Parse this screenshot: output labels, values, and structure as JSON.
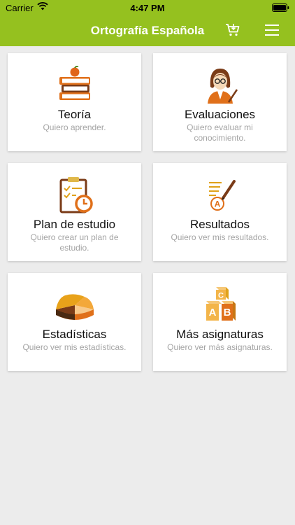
{
  "status_bar": {
    "carrier": "Carrier",
    "time": "4:47 PM"
  },
  "nav": {
    "title": "Ortografía Española",
    "cart_icon": "shopping-cart-icon",
    "menu_icon": "hamburger-menu-icon"
  },
  "colors": {
    "nav_background": "#95c11f",
    "page_background": "#ececec",
    "card_background": "#ffffff",
    "description_text": "#a4a4a4"
  },
  "cards": [
    {
      "label": "Teoría",
      "description": "Quiero aprender.",
      "icon": "books-apple-icon"
    },
    {
      "label": "Evaluaciones",
      "description": "Quiero evaluar mi conocimiento.",
      "icon": "teacher-icon"
    },
    {
      "label": "Plan de estudio",
      "description": "Quiero crear un plan de estudio.",
      "icon": "clipboard-clock-icon"
    },
    {
      "label": "Resultados",
      "description": "Quiero ver mis resultados.",
      "icon": "graded-paper-icon"
    },
    {
      "label": "Estadísticas",
      "description": "Quiero ver mis estadísticas.",
      "icon": "pie-chart-icon"
    },
    {
      "label": "Más asignaturas",
      "description": "Quiero ver más asignaturas.",
      "icon": "abc-blocks-icon"
    }
  ]
}
